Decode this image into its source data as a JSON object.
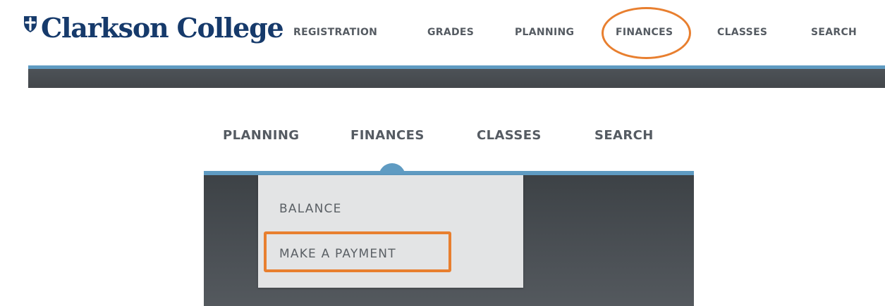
{
  "brand": {
    "name": "Clarkson College",
    "crest_icon": "shield-cross-icon",
    "color": "#163a6b"
  },
  "header_nav": [
    {
      "label": "REGISTRATION",
      "key": "registration"
    },
    {
      "label": "GRADES",
      "key": "grades"
    },
    {
      "label": "PLANNING",
      "key": "planning"
    },
    {
      "label": "FINANCES",
      "key": "finances",
      "highlighted": true
    },
    {
      "label": "CLASSES",
      "key": "classes"
    },
    {
      "label": "SEARCH",
      "key": "search"
    }
  ],
  "zoomed_nav": [
    {
      "label": "PLANNING",
      "key": "planning"
    },
    {
      "label": "FINANCES",
      "key": "finances",
      "active": true
    },
    {
      "label": "CLASSES",
      "key": "classes"
    },
    {
      "label": "SEARCH",
      "key": "search"
    }
  ],
  "finances_dropdown": {
    "items": [
      {
        "label": "BALANCE",
        "key": "balance"
      },
      {
        "label": "MAKE A PAYMENT",
        "key": "make-a-payment",
        "highlighted": true
      }
    ]
  },
  "colors": {
    "nav_text": "#555b62",
    "accent_blue": "#5f9bc2",
    "dark_bar": "#43474b",
    "dropdown_bg": "#e3e4e5",
    "annotation_orange": "#e87f2f"
  }
}
